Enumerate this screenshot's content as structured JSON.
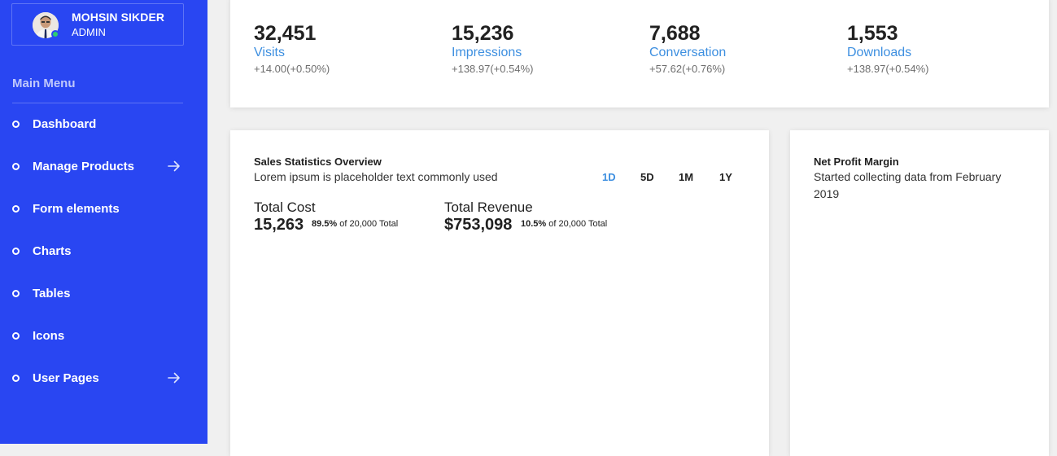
{
  "colors": {
    "sidebar": "#2946f2",
    "accent": "#3d8fe0",
    "online": "#2ecc71"
  },
  "profile": {
    "name": "MOHSIN SIKDER",
    "role": "ADMIN",
    "avatar_icon": "user-avatar"
  },
  "sidebar": {
    "heading": "Main Menu",
    "items": [
      {
        "label": "Dashboard",
        "has_arrow": false
      },
      {
        "label": "Manage Products",
        "has_arrow": true
      },
      {
        "label": "Form elements",
        "has_arrow": false
      },
      {
        "label": "Charts",
        "has_arrow": false
      },
      {
        "label": "Tables",
        "has_arrow": false
      },
      {
        "label": "Icons",
        "has_arrow": false
      },
      {
        "label": "User Pages",
        "has_arrow": true
      }
    ]
  },
  "stats": [
    {
      "value": "32,451",
      "label": "Visits",
      "change": "+14.00(+0.50%)"
    },
    {
      "value": "15,236",
      "label": "Impressions",
      "change": "+138.97(+0.54%)"
    },
    {
      "value": "7,688",
      "label": "Conversation",
      "change": "+57.62(+0.76%)"
    },
    {
      "value": "1,553",
      "label": "Downloads",
      "change": "+138.97(+0.54%)"
    }
  ],
  "sales": {
    "title": "Sales Statistics Overview",
    "subtitle": "Lorem ipsum is placeholder text commonly used",
    "ranges": [
      "1D",
      "5D",
      "1M",
      "1Y"
    ],
    "active_range": "1D",
    "total_cost": {
      "label": "Total Cost",
      "value": "15,263",
      "pct": "89.5%",
      "note": "of 20,000 Total"
    },
    "total_revenue": {
      "label": "Total Revenue",
      "value": "$753,098",
      "pct": "10.5%",
      "note": "of 20,000 Total"
    }
  },
  "profit": {
    "title": "Net Profit Margin",
    "line1": "Started collecting data from February",
    "line2": "2019"
  }
}
